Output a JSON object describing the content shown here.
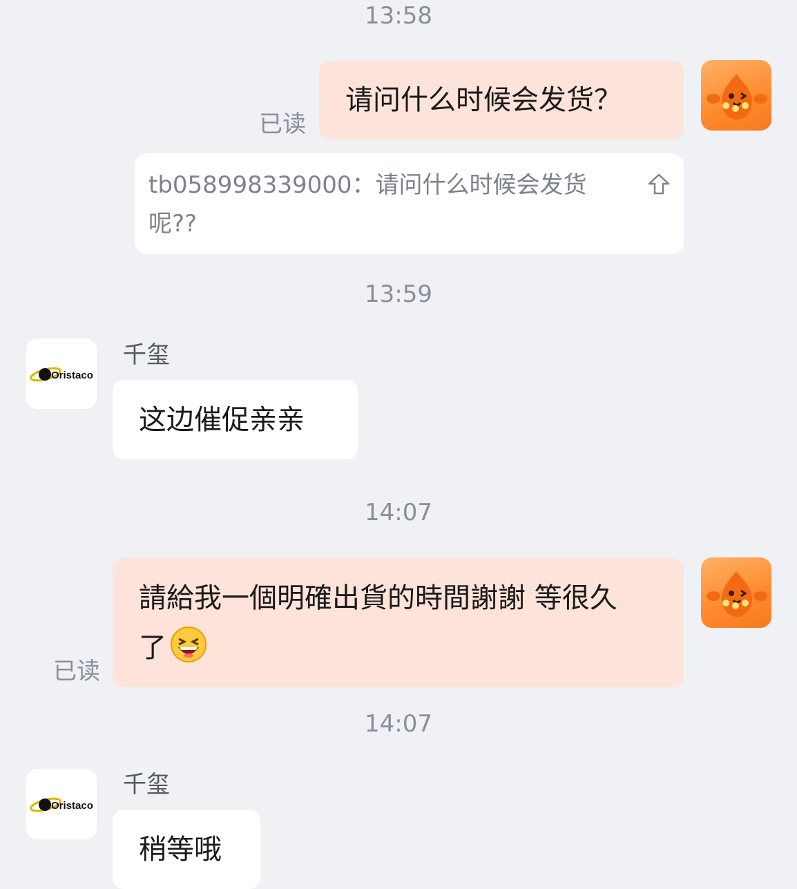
{
  "messages": {
    "ts1": "13:58",
    "ts2": "13:59",
    "ts3": "14:07",
    "ts4": "14:07",
    "msg1_text": "请问什么时候会发货？",
    "msg1_status": "已读",
    "quote_text": "tb058998339000：请问什么时候会发货呢??",
    "msg2_sender": "千玺",
    "msg2_text": "这边催促亲亲",
    "msg3_text": "請給我一個明確出貨的時間謝謝 等很久了",
    "msg3_status": "已读",
    "msg4_sender": "千玺",
    "msg4_text": "稍等哦"
  },
  "shop_logo_text": "Oristaco",
  "icons": {
    "user_avatar": "orange-mascot-avatar",
    "shop_avatar": "oristaco-logo",
    "quote_collapse": "collapse-up-icon",
    "emoji": "laughing-emoji"
  },
  "colors": {
    "background": "#f0f1f5",
    "outgoing_bubble": "#fde3d9",
    "incoming_bubble": "#ffffff",
    "muted_text": "#8a8e99"
  }
}
